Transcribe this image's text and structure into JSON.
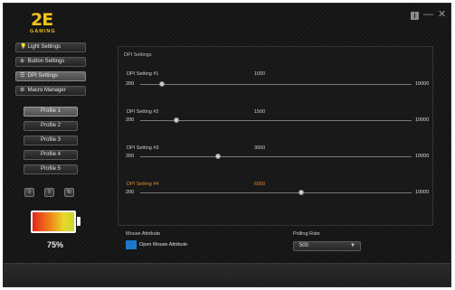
{
  "logo": {
    "brand": "2E",
    "subtitle": "GAMING"
  },
  "window": {
    "info_glyph": "i",
    "minimize_glyph": "—",
    "close_glyph": "✕"
  },
  "nav": [
    {
      "label": "Light Settings",
      "icon": "lightbulb-icon",
      "glyph": "💡",
      "active": false
    },
    {
      "label": "Button Settings",
      "icon": "crosshair-icon",
      "glyph": "⊕",
      "active": false
    },
    {
      "label": "DPI Settings",
      "icon": "dpi-icon",
      "glyph": "☰",
      "active": true
    },
    {
      "label": "Macro Manager",
      "icon": "gear-icon",
      "glyph": "⚙",
      "active": false
    }
  ],
  "profiles": [
    {
      "label": "Profile 1",
      "active": true
    },
    {
      "label": "Profile 2",
      "active": false
    },
    {
      "label": "Profile 3",
      "active": false
    },
    {
      "label": "Profile 4",
      "active": false
    },
    {
      "label": "Profile 5",
      "active": false
    }
  ],
  "profile_actions": [
    {
      "icon": "import-icon",
      "glyph": "⇩"
    },
    {
      "icon": "export-icon",
      "glyph": "⇧"
    },
    {
      "icon": "reset-icon",
      "glyph": "↻"
    }
  ],
  "battery": {
    "percent_text": "75%",
    "level": 0.75
  },
  "dpi": {
    "title": "DPI Settings",
    "min_label": "200",
    "max_label": "10000",
    "min": 200,
    "max": 10000,
    "slots": [
      {
        "label": "DPI Setting #1",
        "value": 1000,
        "value_text": "1000",
        "highlight": false
      },
      {
        "label": "DPI Setting #2",
        "value": 1500,
        "value_text": "1500",
        "highlight": false
      },
      {
        "label": "DPI Setting #3",
        "value": 3000,
        "value_text": "3000",
        "highlight": false
      },
      {
        "label": "DPI Setting #4",
        "value": 6000,
        "value_text": "6000",
        "highlight": true
      }
    ]
  },
  "mouse_attribute": {
    "title": "Mouse Attribute",
    "open_label": "Open Mouse Attribute"
  },
  "polling": {
    "title": "Polling Rate",
    "value": "500"
  },
  "colors": {
    "accent": "#f2c318",
    "highlight": "#e38b2b",
    "checkbox": "#1c78c8"
  }
}
